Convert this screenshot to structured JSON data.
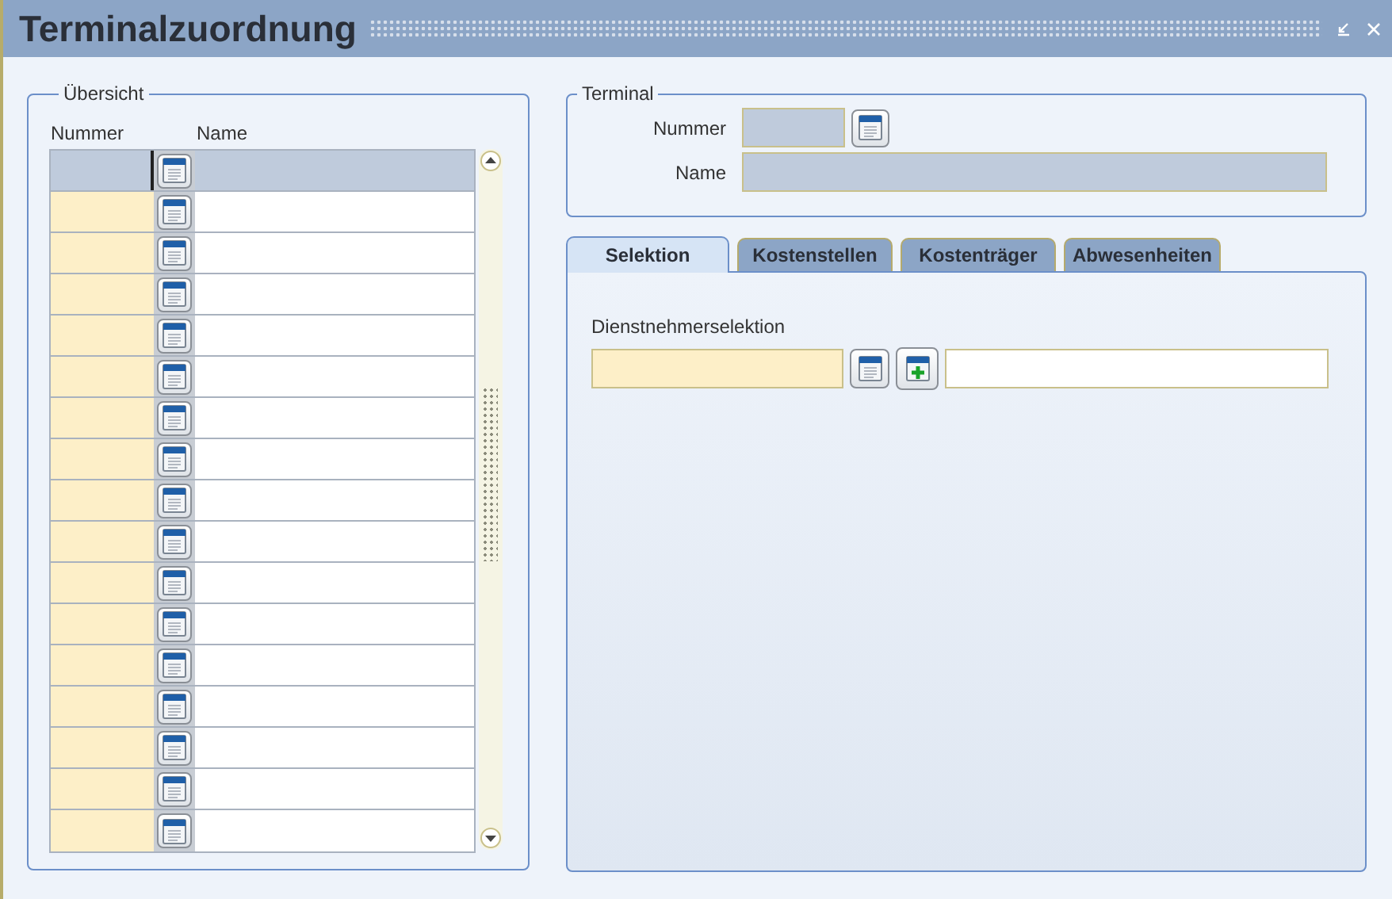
{
  "window": {
    "title": "Terminalzuordnung"
  },
  "overview": {
    "legend": "Übersicht",
    "columns": [
      "Nummer",
      "Name"
    ],
    "rows": [
      {
        "selected": true
      },
      {
        "selected": false
      },
      {
        "selected": false
      },
      {
        "selected": false
      },
      {
        "selected": false
      },
      {
        "selected": false
      },
      {
        "selected": false
      },
      {
        "selected": false
      },
      {
        "selected": false
      },
      {
        "selected": false
      },
      {
        "selected": false
      },
      {
        "selected": false
      },
      {
        "selected": false
      },
      {
        "selected": false
      },
      {
        "selected": false
      },
      {
        "selected": false
      },
      {
        "selected": false
      }
    ]
  },
  "terminal": {
    "legend": "Terminal",
    "fields": [
      {
        "label": "Nummer",
        "kind": "lookup"
      },
      {
        "label": "Name",
        "kind": "wide"
      }
    ]
  },
  "tabs": [
    {
      "label": "Selektion",
      "selected": true
    },
    {
      "label": "Kostenstellen",
      "selected": false
    },
    {
      "label": "Kostenträger",
      "selected": false
    },
    {
      "label": "Abwesenheiten",
      "selected": false
    }
  ],
  "selection": {
    "label": "Dienstnehmerselektion"
  }
}
